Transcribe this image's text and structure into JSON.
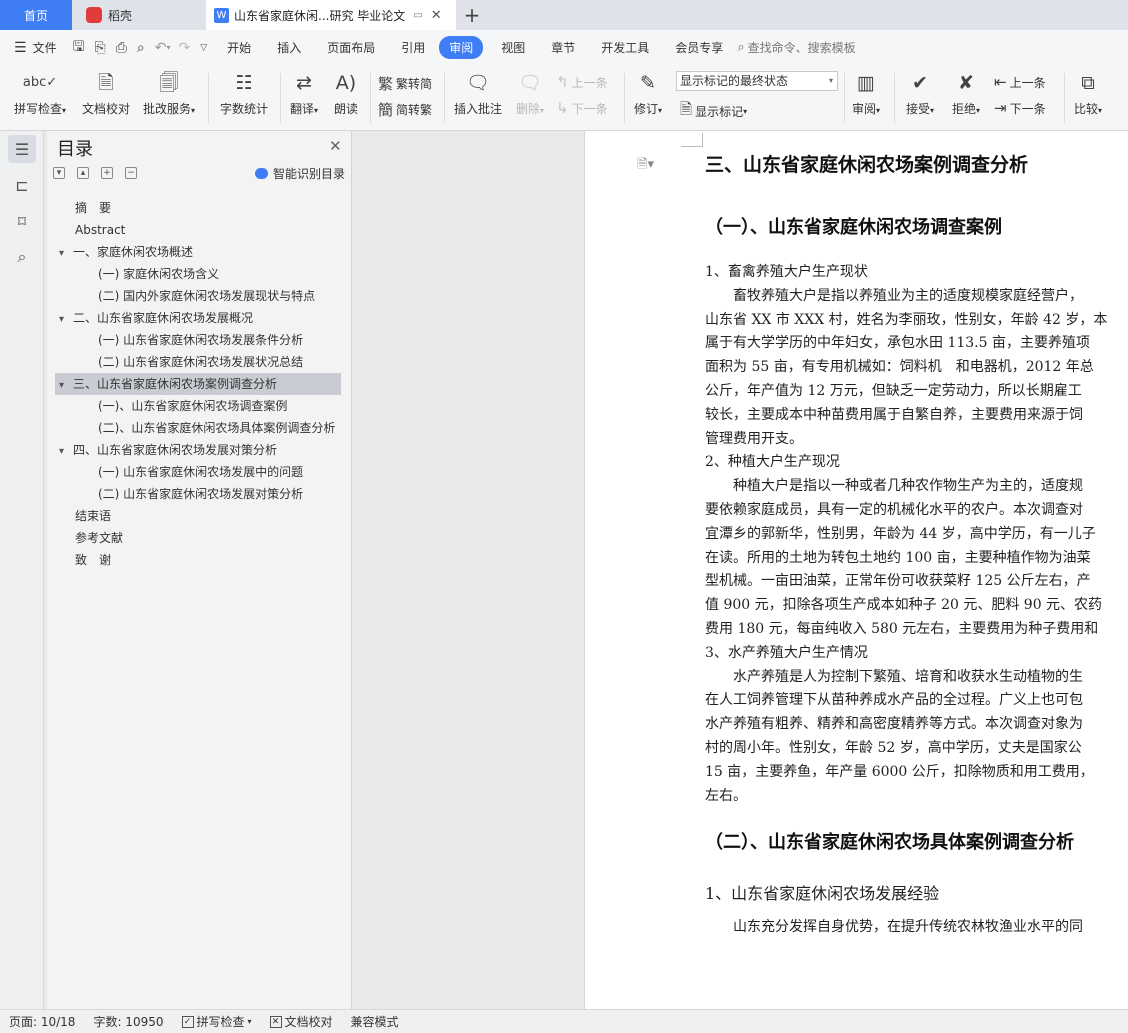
{
  "tabs": {
    "home": "首页",
    "daoke": "稻壳",
    "doc": "山东省家庭休闲...研究 毕业论文",
    "new_tab": "+"
  },
  "menu": {
    "file": "文件",
    "items": [
      "开始",
      "插入",
      "页面布局",
      "引用",
      "审阅",
      "视图",
      "章节",
      "开发工具",
      "会员专享"
    ],
    "search": "查找命令、搜索模板"
  },
  "ribbon": {
    "spellcheck": "拼写检查",
    "doccheck": "文档校对",
    "revise_service": "批改服务",
    "wordcount": "字数统计",
    "translate": "翻译",
    "read": "朗读",
    "trad": "繁转简",
    "simp": "简转繁",
    "insert_comment": "插入批注",
    "delete": "删除",
    "prev_comment": "上一条",
    "next_comment": "下一条",
    "revise": "修订",
    "markup_select": "显示标记的最终状态",
    "show_markup": "显示标记",
    "review": "审阅",
    "accept": "接受",
    "reject": "拒绝",
    "prev_change": "上一条",
    "next_change": "下一条",
    "compare": "比较"
  },
  "toc": {
    "title": "目录",
    "smart": "智能识别目录",
    "items": [
      "摘　要",
      "Abstract",
      "一、家庭休闲农场概述",
      "(一) 家庭休闲农场含义",
      "(二) 国内外家庭休闲农场发展现状与特点",
      "二、山东省家庭休闲农场发展概况",
      "(一) 山东省家庭休闲农场发展条件分析",
      "(二) 山东省家庭休闲农场发展状况总结",
      "三、山东省家庭休闲农场案例调查分析",
      "(一)、山东省家庭休闲农场调查案例",
      "(二)、山东省家庭休闲农场具体案例调查分析",
      "四、山东省家庭休闲农场发展对策分析",
      "(一) 山东省家庭休闲农场发展中的问题",
      "(二) 山东省家庭休闲农场发展对策分析",
      "结束语",
      "参考文献",
      "致　谢"
    ]
  },
  "doc": {
    "h2": "三、山东省家庭休闲农场案例调查分析",
    "h3a": "（一）、山东省家庭休闲农场调查案例",
    "p1": "1、畜禽养殖大户生产现状",
    "p2": "畜牧养殖大户是指以养殖业为主的适度规模家庭经营户，",
    "p3": "山东省 XX 市 XXX 村，姓名为李丽玫，性别女，年龄 42 岁，本",
    "p4": "属于有大学学历的中年妇女，承包水田 113.5 亩，主要养殖项",
    "p5": "面积为 55 亩，有专用机械如：饲料机　和电器机，2012 年总",
    "p6": "公斤，年产值为 12 万元，但缺乏一定劳动力，所以长期雇工",
    "p7": "较长，主要成本中种苗费用属于自繁自养，主要费用来源于饲",
    "p8": "管理费用开支。",
    "p9": "2、种植大户生产现况",
    "p10": "种植大户是指以一种或者几种农作物生产为主的，适度规",
    "p11": "要依赖家庭成员，具有一定的机械化水平的农户。本次调查对",
    "p12": "宜潭乡的郭新华，性别男，年龄为 44 岁，高中学历，有一儿子",
    "p13": "在读。所用的土地为转包土地约 100 亩，主要种植作物为油菜",
    "p14": "型机械。一亩田油菜，正常年份可收获菜籽 125 公斤左右，产",
    "p15": "值 900 元，扣除各项生产成本如种子 20 元、肥料 90 元、农药",
    "p16": "费用 180 元，每亩纯收入 580 元左右，主要费用为种子费用和",
    "p17": "3、水产养殖大户生产情况",
    "p18": "水产养殖是人为控制下繁殖、培育和收获水生动植物的生",
    "p19": "在人工饲养管理下从苗种养成水产品的全过程。广义上也可包",
    "p20": "水产养殖有粗养、精养和高密度精养等方式。本次调查对象为",
    "p21": "村的周小年。性别女，年龄 52 岁，高中学历，丈夫是国家公",
    "p22": "15 亩，主要养鱼，年产量 6000 公斤，扣除物质和用工费用，",
    "p23": "左右。",
    "h3b": "（二）、山东省家庭休闲农场具体案例调查分析",
    "p24": "1、山东省家庭休闲农场发展经验",
    "p25": "山东充分发挥自身优势，在提升传统农林牧渔业水平的同"
  },
  "status": {
    "page": "页面: 10/18",
    "words": "字数: 10950",
    "spell": "拼写检查",
    "check": "文档校对",
    "compat": "兼容模式"
  },
  "colors": {
    "accent": "#3f7df5",
    "toc_selected": "#c9ccd2"
  }
}
